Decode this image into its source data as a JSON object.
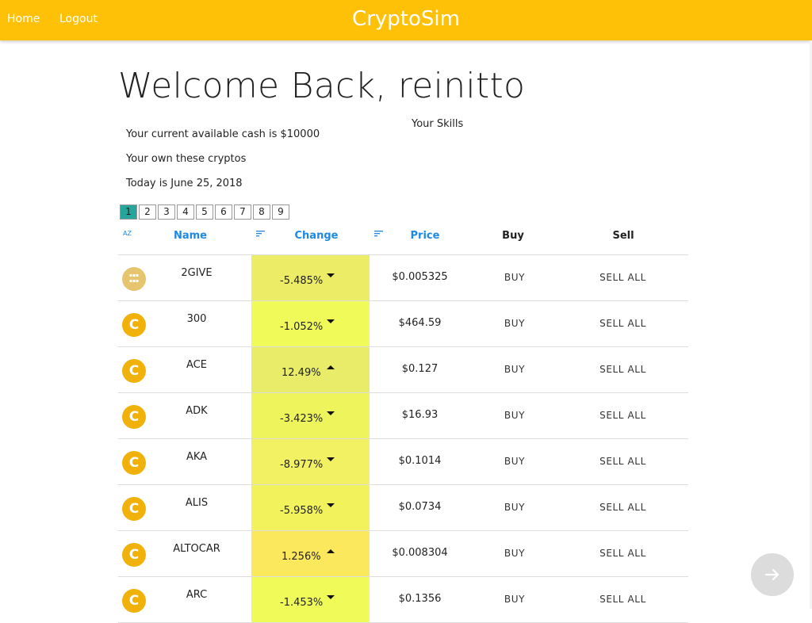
{
  "nav": {
    "home": "Home",
    "logout": "Logout",
    "brand": "CryptoSim"
  },
  "welcome": "Welcome Back, reinitto",
  "info": {
    "cash": "Your current available cash is $10000",
    "owned": "Your own these cryptos",
    "today": "Today is June 25, 2018",
    "skills": "Your Skills"
  },
  "pagination": {
    "active": "1",
    "pages": [
      "1",
      "2",
      "3",
      "4",
      "5",
      "6",
      "7",
      "8",
      "9"
    ]
  },
  "table": {
    "headers": {
      "sort_az": "AZ",
      "name": "Name",
      "change": "Change",
      "price": "Price",
      "buy": "Buy",
      "sell": "Sell"
    },
    "rows": [
      {
        "name": "2GIVE",
        "change": "-5.485%",
        "direction": "down",
        "change_color": "#ecec66",
        "price": "$0.005325",
        "buy": "BUY",
        "sell": "SELL ALL",
        "icon": "2give-logo-icon"
      },
      {
        "name": "300",
        "change": "-1.052%",
        "direction": "down",
        "change_color": "#f0fb5a",
        "price": "$464.59",
        "buy": "BUY",
        "sell": "SELL ALL",
        "icon": "coin-icon"
      },
      {
        "name": "ACE",
        "change": "12.49%",
        "direction": "up",
        "change_color": "#e8ec68",
        "price": "$0.127",
        "buy": "BUY",
        "sell": "SELL ALL",
        "icon": "coin-icon"
      },
      {
        "name": "ADK",
        "change": "-3.423%",
        "direction": "down",
        "change_color": "#eef45c",
        "price": "$16.93",
        "buy": "BUY",
        "sell": "SELL ALL",
        "icon": "coin-icon"
      },
      {
        "name": "AKA",
        "change": "-8.977%",
        "direction": "down",
        "change_color": "#f2f063",
        "price": "$0.1014",
        "buy": "BUY",
        "sell": "SELL ALL",
        "icon": "coin-icon"
      },
      {
        "name": "ALIS",
        "change": "-5.958%",
        "direction": "down",
        "change_color": "#f2f35c",
        "price": "$0.0734",
        "buy": "BUY",
        "sell": "SELL ALL",
        "icon": "coin-icon"
      },
      {
        "name": "ALTOCAR",
        "change": "1.256%",
        "direction": "up",
        "change_color": "#fbe85c",
        "price": "$0.008304",
        "buy": "BUY",
        "sell": "SELL ALL",
        "icon": "coin-icon"
      },
      {
        "name": "ARC",
        "change": "-1.453%",
        "direction": "down",
        "change_color": "#f0fb5a",
        "price": "$0.1356",
        "buy": "BUY",
        "sell": "SELL ALL",
        "icon": "coin-icon"
      }
    ]
  },
  "colors": {
    "topbar": "#ffc107",
    "accent_blue": "#1e88e5",
    "pager_active": "#26a69a",
    "coin": "#f1b10b"
  },
  "fab_icon": "arrow-right-icon"
}
